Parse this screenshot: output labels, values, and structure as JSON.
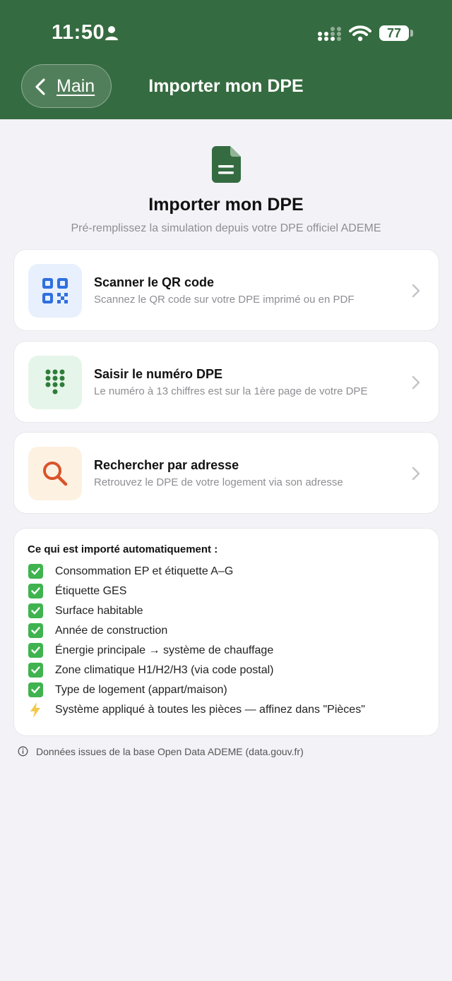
{
  "status_bar": {
    "time": "11:50",
    "battery": "77"
  },
  "nav": {
    "back_label": "Main",
    "title": "Importer mon DPE"
  },
  "hero": {
    "icon": "document-icon",
    "title": "Importer mon DPE",
    "subtitle": "Pré-remplissez la simulation depuis votre DPE officiel ADEME"
  },
  "options": [
    {
      "title": "Scanner le QR code",
      "description": "Scannez le QR code sur votre DPE imprimé ou en PDF",
      "icon": "qr-code-icon",
      "icon_bg": "#e8f0fd",
      "icon_color": "#2f6fe0"
    },
    {
      "title": "Saisir le numéro DPE",
      "description": "Le numéro à 13 chiffres est sur la 1ère page de votre DPE",
      "icon": "keypad-icon",
      "icon_bg": "#e6f5ea",
      "icon_color": "#2e7d3a"
    },
    {
      "title": "Rechercher par adresse",
      "description": "Retrouvez le DPE de votre logement via son adresse",
      "icon": "search-icon",
      "icon_bg": "#fdf1e2",
      "icon_color": "#d9542a"
    }
  ],
  "imported": {
    "title": "Ce qui est importé automatiquement :",
    "items": [
      {
        "icon": "check-icon",
        "text": "Consommation EP et étiquette A–G"
      },
      {
        "icon": "check-icon",
        "text": "Étiquette GES"
      },
      {
        "icon": "check-icon",
        "text": "Surface habitable"
      },
      {
        "icon": "check-icon",
        "text": "Année de construction"
      },
      {
        "icon": "check-icon",
        "text": "Énergie principale → système de chauffage"
      },
      {
        "icon": "check-icon",
        "text": "Zone climatique H1/H2/H3 (via code postal)"
      },
      {
        "icon": "check-icon",
        "text": "Type de logement (appart/maison)"
      },
      {
        "icon": "bolt-icon",
        "text": "Système appliqué à toutes les pièces — affinez dans \"Pièces\""
      }
    ]
  },
  "footer": {
    "text": "Données issues de la base Open Data ADEME (data.gouv.fr)"
  },
  "colors": {
    "header_bg": "#356b40",
    "page_bg": "#f2f2f7",
    "check_green": "#3fb34f",
    "bolt_yellow": "#f2c94c"
  }
}
